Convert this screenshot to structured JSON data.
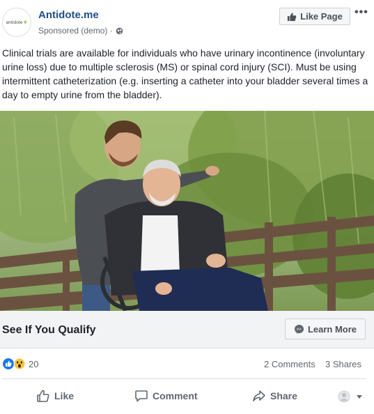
{
  "post": {
    "page_name": "Antidote.me",
    "avatar_text": "antidote",
    "sponsored": "Sponsored (demo) ·",
    "like_page_label": "Like Page",
    "more_label": "•••",
    "body": "Clinical trials are available for individuals who have urinary incontinence (involuntary urine loss) due to multiple sclerosis (MS) or spinal cord injury (SCI). Must be using intermittent catheterization (e.g. inserting a catheter into your bladder several times a day to empty urine from the bladder)."
  },
  "cta": {
    "title": "See If You Qualify",
    "button_label": "Learn More"
  },
  "reactions": {
    "count": "20",
    "comments": "2 Comments",
    "shares": "3 Shares"
  },
  "actions": {
    "like": "Like",
    "comment": "Comment",
    "share": "Share"
  },
  "colors": {
    "page_name": "#1e4f86",
    "like_blue": "#1877f2",
    "wow_yellow": "#f7c644"
  }
}
